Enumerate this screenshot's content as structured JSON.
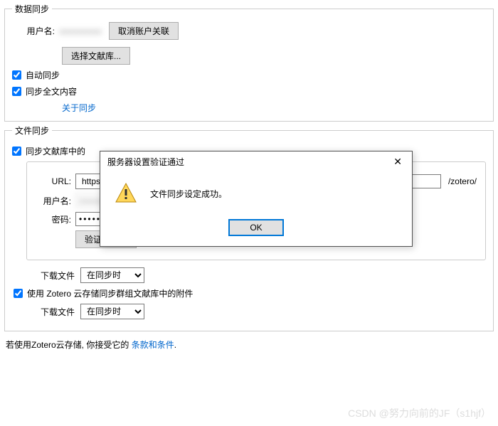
{
  "data_sync": {
    "legend": "数据同步",
    "username_label": "用户名:",
    "username_value": "xxxxxxxxxx",
    "unlink_btn": "取消账户关联",
    "choose_lib_btn": "选择文献库...",
    "auto_sync": "自动同步",
    "sync_fulltext": "同步全文内容",
    "about_link": "关于同步"
  },
  "file_sync": {
    "legend": "文件同步",
    "sync_attachments_cb": "同步文献库中的",
    "url_label": "URL:",
    "protocol": "https",
    "url_value": "",
    "suffix": "/zotero/",
    "username_label": "用户名:",
    "username_value": "xxxxxxxxxx",
    "password_label": "密码:",
    "password_value": "•••••••••••••••••",
    "verify_btn": "验证服务器",
    "download_label": "下载文件",
    "download_option": "在同步时",
    "use_zotero_storage": "使用 Zotero 云存储同步群组文献库中的附件",
    "download_label2": "下载文件",
    "download_option2": "在同步时"
  },
  "footer": {
    "prefix": "若使用Zotero云存储, 你接受它的 ",
    "link": "条款和条件",
    "suffix": "."
  },
  "dialog": {
    "title": "服务器设置验证通过",
    "message": "文件同步设定成功。",
    "ok": "OK"
  },
  "watermark": "CSDN @努力向前的JF（s1hjf）"
}
